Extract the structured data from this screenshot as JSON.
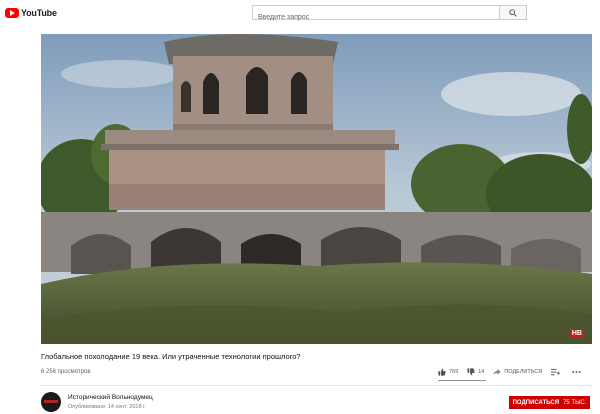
{
  "header": {
    "logo_text": "YouTube",
    "search_placeholder": "Введите запрос",
    "search_icon": "search-icon"
  },
  "video": {
    "watermark": "НВ",
    "title": "Глобальное похолодание 19 века. Или утраченные технологии прошлого?",
    "views": "6 256 просмотров"
  },
  "actions": {
    "likes": "769",
    "dislikes": "14",
    "share_label": "ПОДЕЛИТЬСЯ",
    "more_icon": "more-icon"
  },
  "channel": {
    "name": "Исторический Вольнодумец",
    "published": "Опубликовано: 14 сент. 2018 г."
  },
  "subscribe": {
    "label": "ПОДПИСАТЬСЯ",
    "count": "75 ТЫС."
  },
  "colors": {
    "brand": "#ff0000",
    "subscribe": "#cc0000"
  }
}
